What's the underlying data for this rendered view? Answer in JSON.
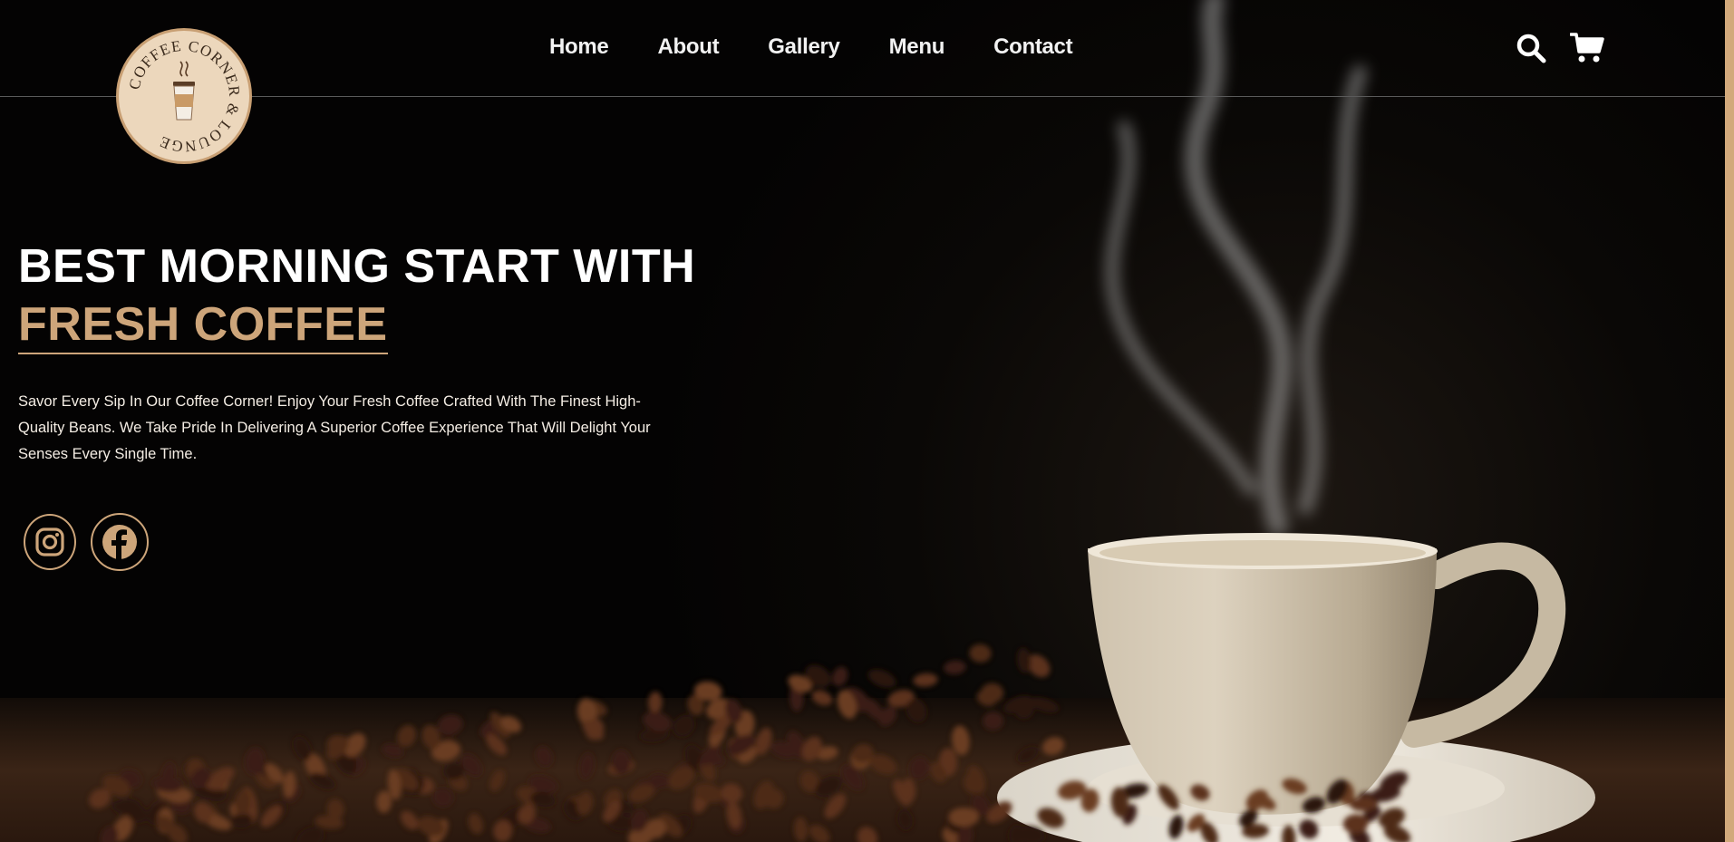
{
  "nav": {
    "items": [
      {
        "label": "Home"
      },
      {
        "label": "About"
      },
      {
        "label": "Gallery"
      },
      {
        "label": "Menu"
      },
      {
        "label": "Contact"
      }
    ]
  },
  "logo": {
    "text": "COFFEE CORNER & LOUNGE",
    "icon": "coffee-cup-icon"
  },
  "header_icons": {
    "search": "search-icon",
    "cart": "shopping-cart-icon"
  },
  "hero": {
    "title_line1": "BEST MORNING START WITH",
    "title_line2": "FRESH COFFEE",
    "description": "Savor Every Sip In Our Coffee Corner! Enjoy Your Fresh Coffee Crafted With The Finest High-Quality Beans. We Take Pride In Delivering A Superior Coffee Experience That Will Delight Your Senses Every Single Time."
  },
  "social": {
    "instagram": "instagram-icon",
    "facebook": "facebook-icon"
  },
  "colors": {
    "accent": "#cda57a",
    "background": "#050403",
    "logo_bg": "#ecd7bc"
  }
}
